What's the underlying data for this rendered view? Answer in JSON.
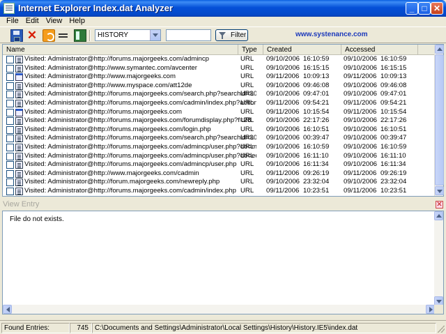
{
  "window": {
    "title": "Internet Explorer Index.dat Analyzer",
    "controls": {
      "minimize": "_",
      "maximize": "□",
      "close": "✕"
    }
  },
  "menu": [
    "File",
    "Edit",
    "View",
    "Help"
  ],
  "toolbar": {
    "icons": [
      "save-icon",
      "delete-icon",
      "clear-icon",
      "equal-icon",
      "book-icon"
    ],
    "history_combo": "HISTORY",
    "filter_input": "",
    "filter_label": "Filter",
    "website": "www.systenance.com"
  },
  "list": {
    "columns": [
      "Name",
      "Type",
      "Created",
      "Accessed"
    ],
    "rows": [
      {
        "icon": "document-icon",
        "name": "Visited: Administrator@http://forums.majorgeeks.com/admincp",
        "type": "URL",
        "created_date": "09/10/2006",
        "created_time": "16:10:59",
        "accessed_date": "09/10/2006",
        "accessed_time": "16:10:59"
      },
      {
        "icon": "document-icon",
        "name": "Visited: Administrator@http://www.symantec.com/avcenter",
        "type": "URL",
        "created_date": "09/10/2006",
        "created_time": "16:15:15",
        "accessed_date": "09/10/2006",
        "accessed_time": "16:15:15"
      },
      {
        "icon": "webpage-icon",
        "name": "Visited: Administrator@http://www.majorgeeks.com",
        "type": "URL",
        "created_date": "09/11/2006",
        "created_time": "10:09:13",
        "accessed_date": "09/11/2006",
        "accessed_time": "10:09:13"
      },
      {
        "icon": "document-icon",
        "name": "Visited: Administrator@http://www.myspace.com/att12de",
        "type": "URL",
        "created_date": "09/10/2006",
        "created_time": "09:46:08",
        "accessed_date": "09/10/2006",
        "accessed_time": "09:46:08"
      },
      {
        "icon": "document-icon",
        "name": "Visited: Administrator@http://forums.majorgeeks.com/search.php?searchid=303032",
        "type": "URL",
        "created_date": "09/10/2006",
        "created_time": "09:47:01",
        "accessed_date": "09/10/2006",
        "accessed_time": "09:47:01"
      },
      {
        "icon": "document-icon",
        "name": "Visited: Administrator@http://forums.majorgeeks.com/cadmin/index.php?action=dlg...",
        "type": "URL",
        "created_date": "09/11/2006",
        "created_time": "09:54:21",
        "accessed_date": "09/11/2006",
        "accessed_time": "09:54:21"
      },
      {
        "icon": "webpage-icon",
        "name": "Visited: Administrator@http://forums.majorgeeks.com",
        "type": "URL",
        "created_date": "09/11/2006",
        "created_time": "10:15:54",
        "accessed_date": "09/11/2006",
        "accessed_time": "10:15:54"
      },
      {
        "icon": "document-icon",
        "name": "Visited: Administrator@http://forums.majorgeeks.com/forumdisplay.php?f=28",
        "type": "URL",
        "created_date": "09/10/2006",
        "created_time": "22:17:26",
        "accessed_date": "09/10/2006",
        "accessed_time": "22:17:26"
      },
      {
        "icon": "document-icon",
        "name": "Visited: Administrator@http://forums.majorgeeks.com/login.php",
        "type": "URL",
        "created_date": "09/10/2006",
        "created_time": "16:10:51",
        "accessed_date": "09/10/2006",
        "accessed_time": "16:10:51"
      },
      {
        "icon": "document-icon",
        "name": "Visited: Administrator@http://forums.majorgeeks.com/search.php?searchid=302941",
        "type": "URL",
        "created_date": "09/10/2006",
        "created_time": "00:39:47",
        "accessed_date": "09/10/2006",
        "accessed_time": "00:39:47"
      },
      {
        "icon": "document-icon",
        "name": "Visited: Administrator@http://forums.majorgeeks.com/admincp/user.php?do=modify",
        "type": "URL",
        "created_date": "09/10/2006",
        "created_time": "16:10:59",
        "accessed_date": "09/10/2006",
        "accessed_time": "16:10:59"
      },
      {
        "icon": "document-icon",
        "name": "Visited: Administrator@http://forums.majorgeeks.com/admincp/user.php?do=edit...",
        "type": "URL",
        "created_date": "09/10/2006",
        "created_time": "16:11:10",
        "accessed_date": "09/10/2006",
        "accessed_time": "16:11:10"
      },
      {
        "icon": "document-icon",
        "name": "Visited: Administrator@http://forums.majorgeeks.com/admincp/user.php",
        "type": "URL",
        "created_date": "09/10/2006",
        "created_time": "16:11:34",
        "accessed_date": "09/10/2006",
        "accessed_time": "16:11:34"
      },
      {
        "icon": "document-icon",
        "name": "Visited: Administrator@http://www.majorgeeks.com/cadmin",
        "type": "URL",
        "created_date": "09/11/2006",
        "created_time": "09:26:19",
        "accessed_date": "09/11/2006",
        "accessed_time": "09:26:19"
      },
      {
        "icon": "document-icon",
        "name": "Visited: Administrator@http://forum.majorgeeks.com/newreply.php",
        "type": "URL",
        "created_date": "09/10/2006",
        "created_time": "23:32:04",
        "accessed_date": "09/10/2006",
        "accessed_time": "23:32:04"
      },
      {
        "icon": "document-icon",
        "name": "Visited: Administrator@http://forums.majorgeeks.com/cadmin/index.php",
        "type": "URL",
        "created_date": "09/11/2006",
        "created_time": "10:23:51",
        "accessed_date": "09/11/2006",
        "accessed_time": "10:23:51"
      }
    ]
  },
  "view_entry": {
    "title": "View Entry",
    "close": "✕",
    "content": "File do not exists."
  },
  "status": {
    "label": "Found Entries:",
    "count": "745",
    "path": "C:\\Documents and Settings\\Administrator\\Local Settings\\History\\History.IE5\\index.dat"
  },
  "colors": {
    "titlebar": "#0550d8",
    "link": "#1c39bb",
    "window_bg": "#ece9d8"
  }
}
